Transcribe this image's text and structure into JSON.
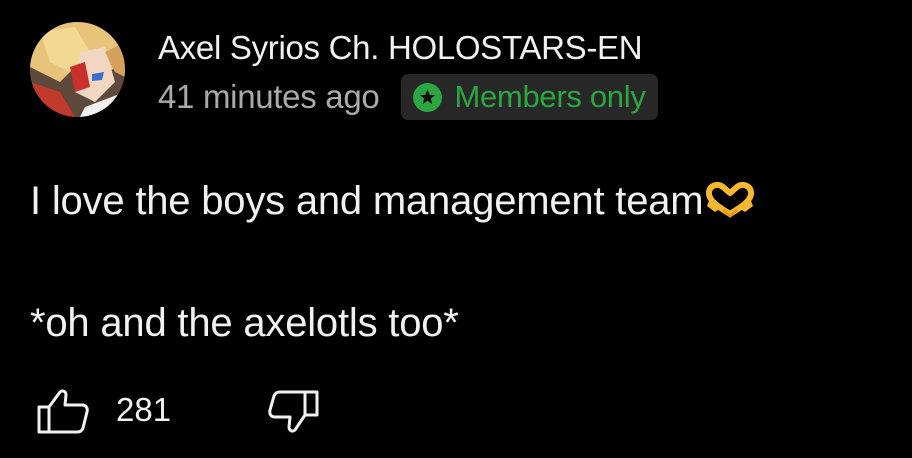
{
  "comment": {
    "author": "Axel Syrios Ch. HOLOSTARS-EN",
    "timestamp": "41 minutes ago",
    "badge": {
      "label": "Members only",
      "icon": "star-icon",
      "color": "#2ba640"
    },
    "text_lines": [
      "I love the boys and management team",
      "*oh and the axelotls too*"
    ],
    "emoji": "heart-hands-emoji",
    "like_count": "281"
  },
  "actions": {
    "like_icon": "thumbs-up-icon",
    "dislike_icon": "thumbs-down-icon"
  },
  "colors": {
    "background": "#000000",
    "primary_text": "#f1f1f1",
    "secondary_text": "#aaaaaa",
    "badge_background": "#272727",
    "members_green": "#2ba640"
  }
}
